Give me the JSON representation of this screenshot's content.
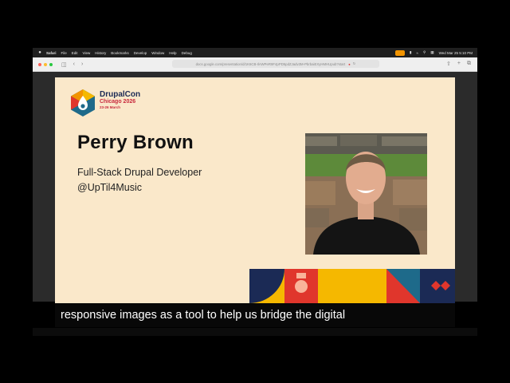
{
  "menubar": {
    "app": "Safari",
    "items": [
      "File",
      "Edit",
      "View",
      "History",
      "Bookmarks",
      "Develop",
      "Window",
      "Help",
      "Debug"
    ],
    "clock": "Wed Mar 25  5:10 PM"
  },
  "browser": {
    "url": "docs.google.com/presentation/d/1K6CB-IlAWPeR9F4pPD5pdZJadv3M-PbrbaiEXyHMHUpub?start",
    "icons": [
      "back-icon",
      "forward-icon",
      "sidebar-icon",
      "share-icon",
      "new-tab-icon",
      "tabs-icon",
      "mic-icon"
    ]
  },
  "slide": {
    "logo": {
      "name": "DrupalCon",
      "city": "Chicago 2026",
      "dates": "23-26 March"
    },
    "speaker_name": "Perry Brown",
    "role": "Full-Stack Drupal Developer",
    "handle": "@UpTil4Music"
  },
  "caption": "responsive images as a tool to help us bridge the digital",
  "colors": {
    "slide_bg": "#fae8ca",
    "navy": "#1b2a55",
    "red": "#e0362c",
    "yellow": "#f5b800",
    "teal": "#1e6a8a",
    "logo_red": "#c8283c"
  }
}
